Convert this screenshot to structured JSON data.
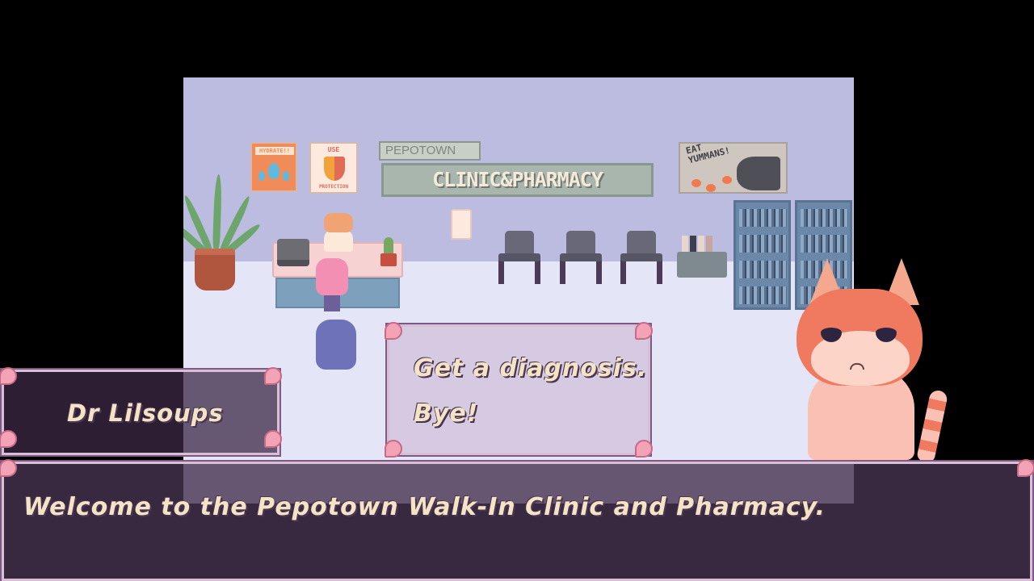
{
  "scene": {
    "poster_hydrate": "HYDRATE!!",
    "poster_protection_top": "USE",
    "poster_protection_bottom": "PROTECTION",
    "sign_small": "PEPOTOWN",
    "sign_big": "CLINIC&PHARMACY",
    "ad_poster": "EAT\nYUMMANS!"
  },
  "choices": {
    "option_1": "Get a diagnosis.",
    "option_2": "Bye!"
  },
  "speaker": {
    "name": "Dr Lilsoups"
  },
  "dialog": {
    "text": "Welcome to the Pepotown Walk-In Clinic and Pharmacy."
  },
  "colors": {
    "wall": "#bbbce0",
    "floor": "#e4e5f7",
    "panel_border": "#d9bfd6",
    "text": "#f4e3c4",
    "cat_orange": "#f07a5f"
  }
}
